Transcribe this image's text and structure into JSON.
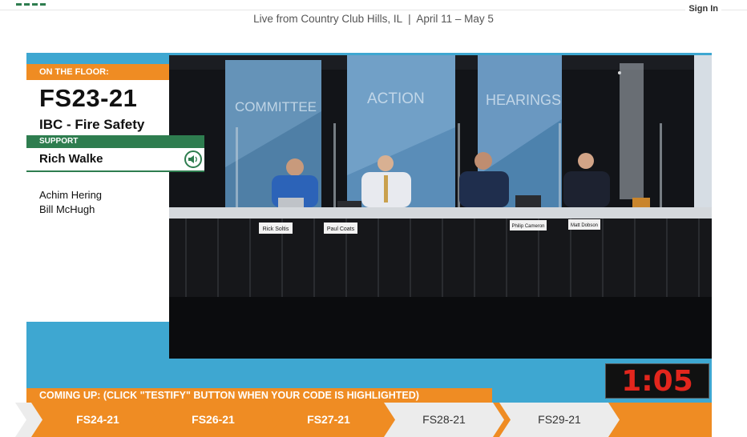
{
  "header": {
    "sign_in_label": "Sign In",
    "subtitle": "Live from Country Club Hills, IL  |  April 11 – May 5"
  },
  "on_floor": {
    "badge": "ON THE FLOOR:",
    "code": "FS23-21",
    "name": "IBC - Fire Safety"
  },
  "support": {
    "label": "SUPPORT",
    "current_speaker": "Rich Walke",
    "queue": [
      "Achim Hering",
      "Bill McHugh"
    ]
  },
  "video": {
    "backdrop_words": [
      "COMMITTEE",
      "ACTION",
      "HEARINGS"
    ],
    "nameplates": [
      "Rick Soltis",
      "Paul Coats",
      "Philip Cameron",
      "Matt Dobson"
    ]
  },
  "timer": "1:05",
  "coming_up": {
    "label": "COMING UP: (CLICK \"TESTIFY\" BUTTON WHEN YOUR CODE IS HIGHLIGHTED)",
    "items": [
      {
        "code": "FS24-21",
        "state": "highlighted"
      },
      {
        "code": "FS26-21",
        "state": "highlighted"
      },
      {
        "code": "FS27-21",
        "state": "highlighted"
      },
      {
        "code": "FS28-21",
        "state": "normal"
      },
      {
        "code": "FS29-21",
        "state": "normal"
      }
    ]
  },
  "colors": {
    "accent_orange": "#ef8c23",
    "frame_blue": "#3ea7d1",
    "support_green": "#2e7d4f",
    "timer_red": "#e3261d"
  }
}
